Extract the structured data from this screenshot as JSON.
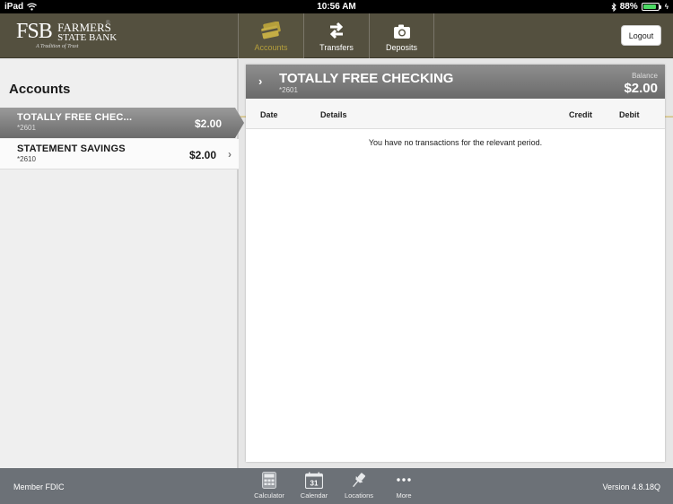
{
  "status_bar": {
    "device": "iPad",
    "time": "10:56 AM",
    "battery_percent": "88%",
    "battery_level": 0.88
  },
  "header": {
    "logo": {
      "abbr": "FSB",
      "name_line1": "FARMERS",
      "name_line2": "STATE BANK",
      "tagline": "A Tradition of Trust",
      "reg": "®"
    },
    "nav": [
      {
        "label": "Accounts",
        "icon": "credit-card-icon",
        "active": true
      },
      {
        "label": "Transfers",
        "icon": "transfer-arrows-icon",
        "active": false
      },
      {
        "label": "Deposits",
        "icon": "camera-icon",
        "active": false
      }
    ],
    "logout_label": "Logout"
  },
  "sidebar": {
    "title": "Accounts",
    "accounts": [
      {
        "name": "TOTALLY FREE CHEC...",
        "number": "*2601",
        "amount": "$2.00",
        "selected": true
      },
      {
        "name": "STATEMENT SAVINGS",
        "number": "*2610",
        "amount": "$2.00",
        "selected": false
      }
    ]
  },
  "detail": {
    "title": "TOTALLY FREE CHECKING",
    "number": "*2601",
    "balance_label": "Balance",
    "balance": "$2.00",
    "columns": [
      "Date",
      "Details",
      "Credit",
      "Debit"
    ],
    "empty_message": "You have no transactions for the relevant period."
  },
  "footer": {
    "left_text": "Member FDIC",
    "version": "Version 4.8.18Q",
    "tools": [
      {
        "label": "Calculator",
        "icon": "calculator-icon"
      },
      {
        "label": "Calendar",
        "icon": "calendar-icon",
        "icon_text": "31"
      },
      {
        "label": "Locations",
        "icon": "map-pin-icon"
      },
      {
        "label": "More",
        "icon": "more-dots-icon"
      }
    ]
  }
}
